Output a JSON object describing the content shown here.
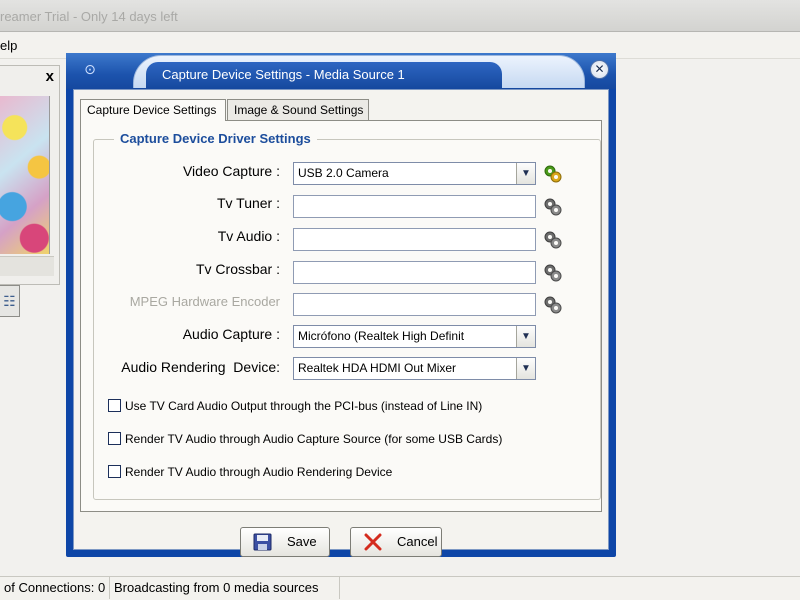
{
  "app": {
    "title_fragment": "reamer Trial - Only 14 days left",
    "menu_help": "elp"
  },
  "preview_panel": {
    "close_glyph": "x"
  },
  "statusbar": {
    "connections": "of Connections: 0",
    "broadcasting": "Broadcasting from 0 media sources"
  },
  "dialog": {
    "title": "Capture Device Settings - Media Source 1",
    "tabs": [
      {
        "label": "Capture Device Settings",
        "active": true
      },
      {
        "label": "Image & Sound Settings",
        "active": false
      }
    ],
    "group_title": "Capture Device Driver Settings",
    "fields": {
      "video_capture": {
        "label": "Video Capture :",
        "value": "USB 2.0 Camera"
      },
      "tv_tuner": {
        "label": "Tv Tuner :",
        "value": ""
      },
      "tv_audio": {
        "label": "Tv Audio :",
        "value": ""
      },
      "tv_crossbar": {
        "label": "Tv Crossbar :",
        "value": ""
      },
      "mpeg_encoder": {
        "label": "MPEG Hardware Encoder",
        "value": ""
      },
      "audio_capture": {
        "label": "Audio Capture :",
        "value": "Micrófono (Realtek High Definit"
      },
      "audio_rendering": {
        "label": "Audio Rendering  Device:",
        "value": "Realtek HDA HDMI Out Mixer"
      }
    },
    "checkboxes": [
      {
        "label": "Use TV Card Audio Output through the PCI-bus (instead of Line IN)",
        "checked": false
      },
      {
        "label": "Render TV Audio through Audio Capture Source (for some USB Cards)",
        "checked": false
      },
      {
        "label": "Render TV Audio through Audio Rendering Device",
        "checked": false
      }
    ],
    "buttons": {
      "save": "Save",
      "cancel": "Cancel"
    }
  },
  "colors": {
    "dialog_frame": "#0e46a7",
    "group_title": "#1c4d9c",
    "gear_active": "#4a9a1a",
    "gear_inactive": "#6d6d6d",
    "cancel_x": "#d42b1e",
    "save_disk": "#3b4fa3"
  },
  "icons": {
    "video_capture_gear": "gear-green-icon",
    "other_gears": "gear-gray-icon",
    "save": "floppy-disk-icon",
    "cancel": "red-x-icon",
    "dropdown": "chevron-down-icon"
  }
}
